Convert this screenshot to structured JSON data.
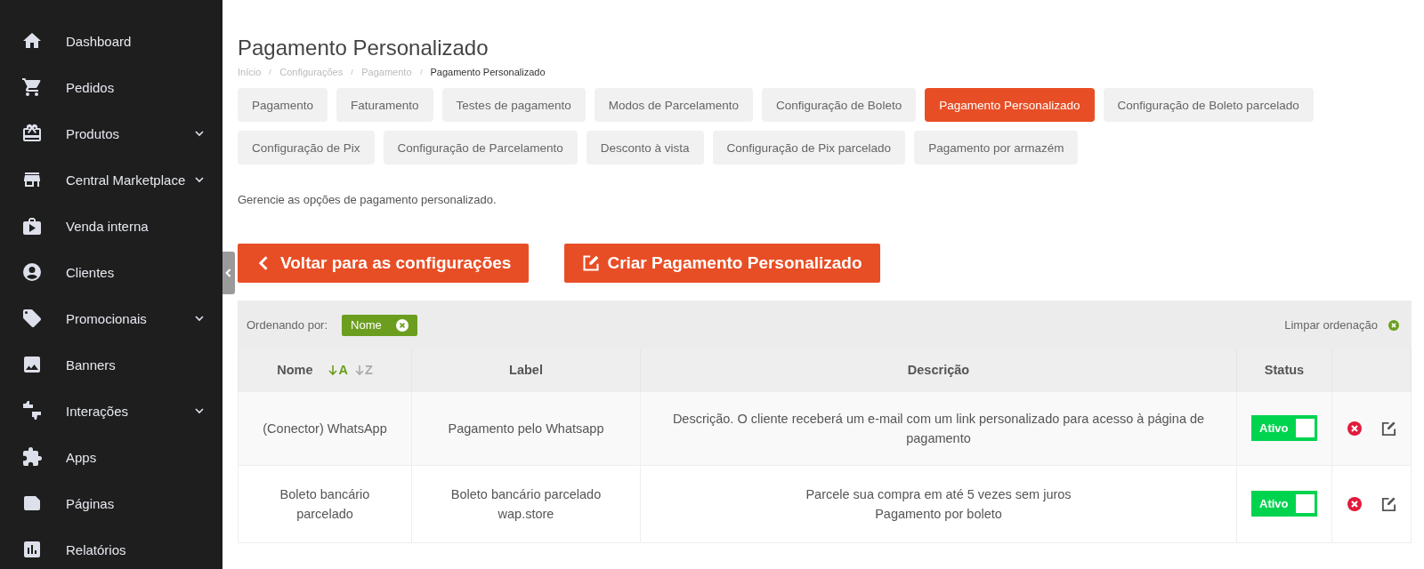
{
  "sidebar": {
    "items": [
      {
        "label": "Dashboard",
        "expandable": false
      },
      {
        "label": "Pedidos",
        "expandable": false
      },
      {
        "label": "Produtos",
        "expandable": true
      },
      {
        "label": "Central Marketplace",
        "expandable": true
      },
      {
        "label": "Venda interna",
        "expandable": false
      },
      {
        "label": "Clientes",
        "expandable": false
      },
      {
        "label": "Promocionais",
        "expandable": true
      },
      {
        "label": "Banners",
        "expandable": false
      },
      {
        "label": "Interações",
        "expandable": true
      },
      {
        "label": "Apps",
        "expandable": false
      },
      {
        "label": "Páginas",
        "expandable": false
      },
      {
        "label": "Relatórios",
        "expandable": false
      }
    ]
  },
  "page": {
    "title": "Pagamento Personalizado",
    "breadcrumb": [
      "Início",
      "Configurações",
      "Pagamento",
      "Pagamento Personalizado"
    ],
    "tabs": [
      {
        "label": "Pagamento",
        "selected": false
      },
      {
        "label": "Faturamento",
        "selected": false
      },
      {
        "label": "Testes de pagamento",
        "selected": false
      },
      {
        "label": "Modos de Parcelamento",
        "selected": false
      },
      {
        "label": "Configuração de Boleto",
        "selected": false
      },
      {
        "label": "Pagamento Personalizado",
        "selected": true
      },
      {
        "label": "Configuração de Boleto parcelado",
        "selected": false
      },
      {
        "label": "Configuração de Pix",
        "selected": false
      },
      {
        "label": "Configuração de Parcelamento",
        "selected": false
      },
      {
        "label": "Desconto à vista",
        "selected": false
      },
      {
        "label": "Configuração de Pix parcelado",
        "selected": false
      },
      {
        "label": "Pagamento por armazém",
        "selected": false
      }
    ],
    "description": "Gerencie as opções de pagamento personalizado.",
    "buttons": [
      {
        "kind": "back",
        "label": "Voltar para as configurações"
      },
      {
        "kind": "create",
        "label": "Criar Pagamento Personalizado"
      }
    ]
  },
  "sort_bar": {
    "label": "Ordenando por:",
    "chip": "Nome",
    "clear": "Limpar ordenação"
  },
  "table": {
    "columns": [
      {
        "label": "Nome",
        "sort_options": [
          {
            "label": "A",
            "selected": true
          },
          {
            "label": "Z",
            "selected": false
          }
        ]
      },
      {
        "label": "Label"
      },
      {
        "label": "Descrição"
      },
      {
        "label": "Status"
      }
    ],
    "rows": [
      {
        "name": "(Conector) WhatsApp",
        "label": "Pagamento pelo Whatsapp",
        "description": [
          "Descrição. O cliente receberá um e-mail com um link personalizado para acesso à página de pagamento"
        ],
        "status": "Ativo",
        "on": true
      },
      {
        "name": "Boleto bancário parcelado",
        "label": "Boleto bancário parcelado wap.store",
        "description": [
          "Parcele sua compra em até 5 vezes sem juros",
          "Pagamento por boleto"
        ],
        "status": "Ativo",
        "on": true
      }
    ]
  }
}
